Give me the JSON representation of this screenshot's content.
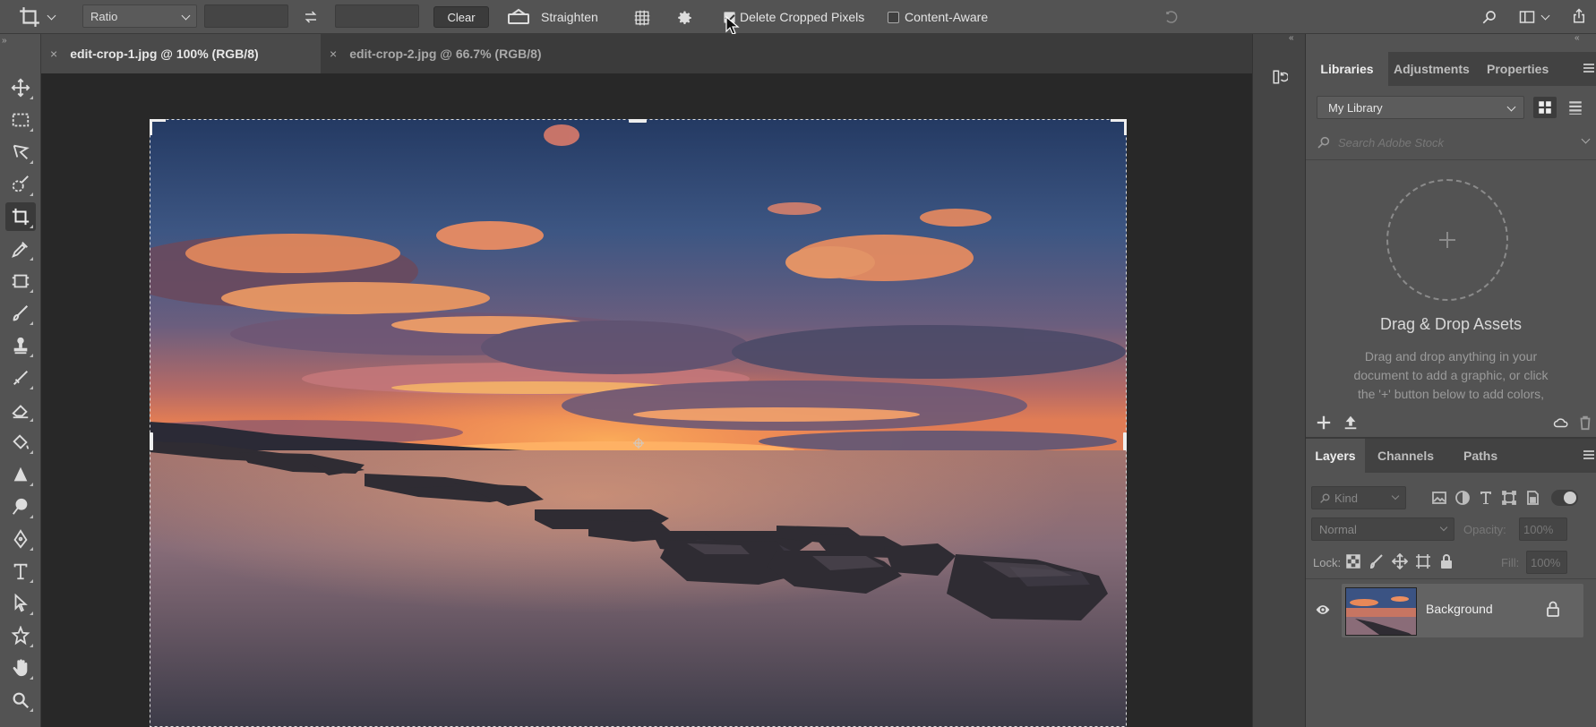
{
  "options_bar": {
    "ratio_label": "Ratio",
    "clear_label": "Clear",
    "straighten_label": "Straighten",
    "delete_cropped_label": "Delete Cropped Pixels",
    "delete_cropped_checked": true,
    "content_aware_label": "Content-Aware",
    "content_aware_checked": false
  },
  "tabs": [
    {
      "close": "×",
      "label": "edit-crop-1.jpg @ 100% (RGB/8)",
      "active": true
    },
    {
      "close": "×",
      "label": "edit-crop-2.jpg @ 66.7% (RGB/8)",
      "active": false
    }
  ],
  "tools": [
    "move-tool",
    "marquee-tool",
    "lasso-tool",
    "quick-selection-tool",
    "crop-tool",
    "eyedropper-tool",
    "frame-tool",
    "brush-tool",
    "clone-stamp-tool",
    "healing-brush-tool",
    "eraser-tool",
    "paint-bucket-tool",
    "sharpen-tool",
    "dodge-tool",
    "pen-tool",
    "type-tool",
    "path-selection-tool",
    "custom-shape-tool",
    "hand-tool",
    "zoom-tool"
  ],
  "libraries_panel": {
    "tabs": [
      "Libraries",
      "Adjustments",
      "Properties"
    ],
    "library_select": "My Library",
    "search_placeholder": "Search Adobe Stock",
    "dropzone_title": "Drag & Drop Assets",
    "dropzone_text_1": "Drag and drop anything in your",
    "dropzone_text_2": "document to add a graphic, or click",
    "dropzone_text_3": "the '+' button below to add colors,"
  },
  "layers_panel": {
    "tabs": [
      "Layers",
      "Channels",
      "Paths"
    ],
    "filter_kind": "Kind",
    "blend_mode": "Normal",
    "opacity_label": "Opacity:",
    "opacity_value": "100%",
    "lock_label": "Lock:",
    "fill_label": "Fill:",
    "fill_value": "100%",
    "layers": [
      {
        "name": "Background",
        "locked": true,
        "visible": true
      }
    ]
  },
  "colors": {
    "accent_ui": "#535353",
    "canvas_bg": "#282828"
  }
}
